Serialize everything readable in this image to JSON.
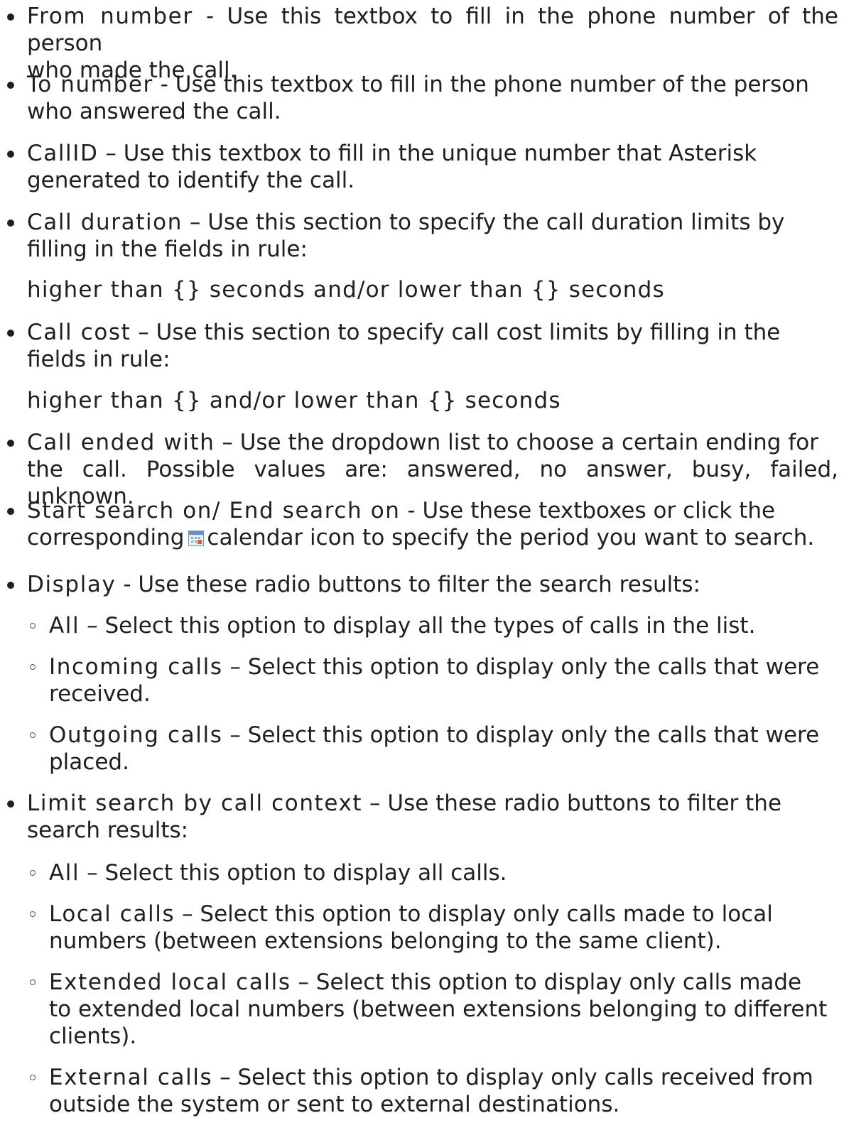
{
  "items": [
    {
      "label": "From number",
      "desc_1": " - Use this textbox to fill in the phone number of the person",
      "desc_2": "who made the call."
    },
    {
      "label": "To number",
      "desc_1": " - Use this textbox to fill in the phone number of the person",
      "desc_2": "who answered the call."
    },
    {
      "label": "CallID",
      "desc_1": " – Use this textbox to fill in the unique number that Asterisk",
      "desc_2": "generated to identify the call."
    },
    {
      "label": "Call duration",
      "desc_1": " – Use this section to specify the call duration limits by",
      "desc_2": "filling in the fields in rule:",
      "rule": "higher than {} seconds and/or lower than {} seconds"
    },
    {
      "label": "Call cost",
      "desc_1": " – Use this section to specify call cost limits by filling in the",
      "desc_2": "fields in rule:",
      "rule": "higher than {} and/or lower than {} seconds"
    },
    {
      "label": "Call ended with",
      "desc_1": " – Use the dropdown list to choose a certain ending for",
      "desc_2": "the call. Possible values are: answered, no answer, busy, failed, unknown."
    },
    {
      "label": "Start search on/ End search on",
      "desc_1": " - Use these textboxes or click the",
      "desc_2a": "corresponding",
      "desc_2b": "calendar icon to specify the period you want to search."
    },
    {
      "label": "Display",
      "desc_1": " - Use these radio buttons to filter the search results:"
    },
    {
      "label": "Limit search by call context",
      "desc_1": " – Use these radio buttons to filter the",
      "desc_2": "search results:"
    }
  ],
  "display_options": [
    {
      "label": "All",
      "desc_1": " – Select this option to display all the types of calls in the list."
    },
    {
      "label": "Incoming calls",
      "desc_1": " – Select this option to display only the calls that were",
      "desc_2": "received."
    },
    {
      "label": "Outgoing calls",
      "desc_1": " – Select this option to display only the calls that were",
      "desc_2": "placed."
    }
  ],
  "context_options": [
    {
      "label": "All",
      "desc_1": " – Select this option to display all calls."
    },
    {
      "label": "Local calls",
      "desc_1": " – Select this option to display only calls made to local",
      "desc_2": "numbers (between extensions belonging to the same client)."
    },
    {
      "label": "Extended local calls",
      "desc_1": " – Select this option to display only calls made",
      "desc_2": "to extended local numbers (between extensions belonging to different",
      "desc_3": "clients)."
    },
    {
      "label": "External calls",
      "desc_1": " – Select this option to display only calls received from",
      "desc_2": "outside the system or sent to external destinations."
    }
  ],
  "icons": {
    "calendar": "calendar-icon"
  }
}
